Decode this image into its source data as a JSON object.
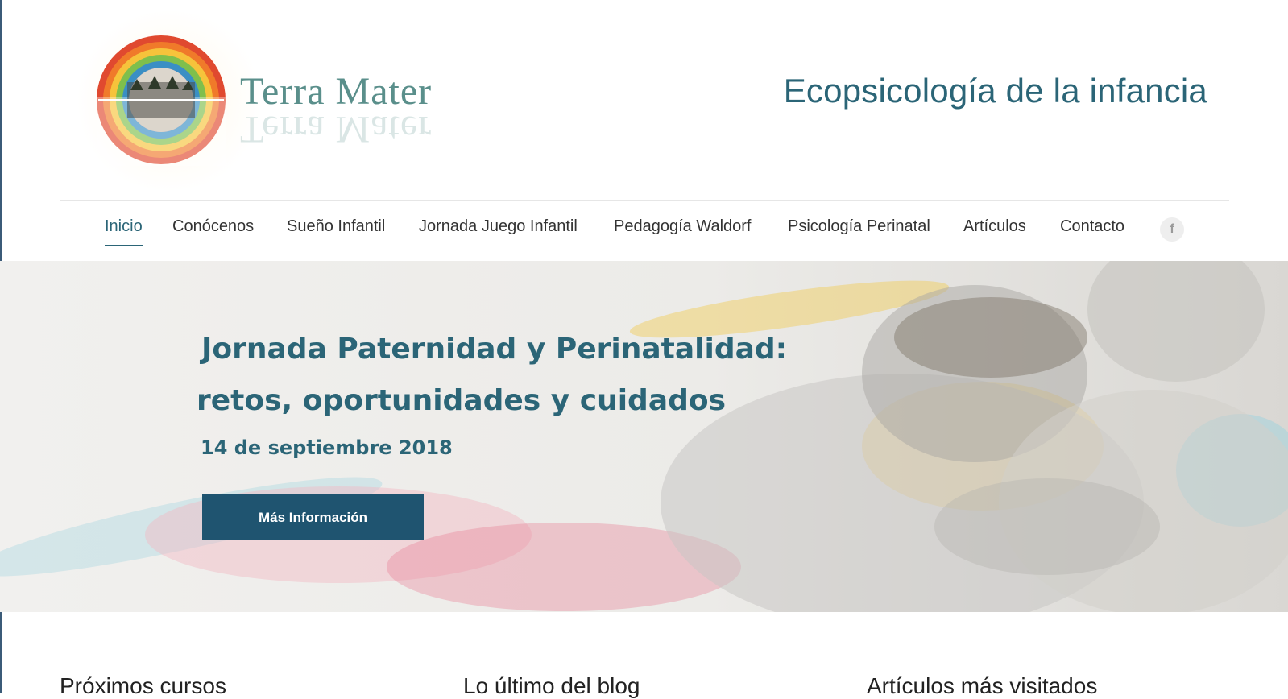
{
  "brand": {
    "name": "Terra Mater",
    "tagline": "Ecopsicología de la infancia"
  },
  "nav": {
    "items": [
      {
        "label": "Inicio",
        "active": true
      },
      {
        "label": "Conócenos"
      },
      {
        "label": "Sueño Infantil"
      },
      {
        "label": "Jornada Juego Infantil"
      },
      {
        "label": "Pedagogía Waldorf"
      },
      {
        "label": "Psicología Perinatal"
      },
      {
        "label": "Artículos"
      },
      {
        "label": "Contacto"
      }
    ],
    "social_icon": "facebook-icon",
    "social_glyph": "f"
  },
  "hero": {
    "title_line1": "Jornada Paternidad y Perinatalidad:",
    "title_line2": "retos, oportunidades y cuidados",
    "date": "14 de septiembre 2018",
    "button_label": "Más Información"
  },
  "widgets": [
    {
      "title": "Próximos cursos"
    },
    {
      "title": "Lo último del blog"
    },
    {
      "title": "Artículos más visitados"
    }
  ],
  "colors": {
    "accent": "#2b6577",
    "button": "#1f5470",
    "logo_text": "#5a8f8b"
  }
}
